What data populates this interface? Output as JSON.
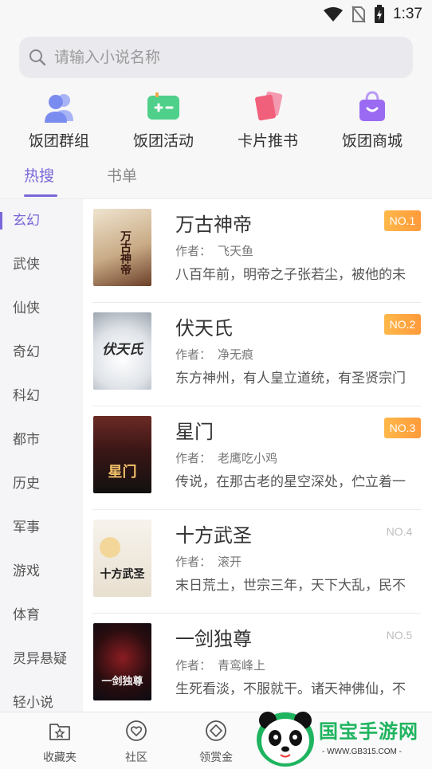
{
  "status_bar": {
    "time": "1:37",
    "icons": [
      "wifi-icon",
      "no-sim-icon",
      "battery-charging-icon"
    ]
  },
  "search": {
    "placeholder": "请输入小说名称",
    "icon": "search-icon"
  },
  "quick_actions": [
    {
      "label": "饭团群组",
      "icon": "group-icon",
      "color": "#7b8cf0"
    },
    {
      "label": "饭团活动",
      "icon": "gamepad-icon",
      "color": "#4fd08a"
    },
    {
      "label": "卡片推书",
      "icon": "cards-icon",
      "color": "#f0607a"
    },
    {
      "label": "饭团商城",
      "icon": "shopping-bag-icon",
      "color": "#9b6af2"
    }
  ],
  "tabs": [
    {
      "label": "热搜",
      "active": true
    },
    {
      "label": "书单",
      "active": false
    }
  ],
  "categories": [
    {
      "label": "玄幻",
      "active": true
    },
    {
      "label": "武侠"
    },
    {
      "label": "仙侠"
    },
    {
      "label": "奇幻"
    },
    {
      "label": "科幻"
    },
    {
      "label": "都市"
    },
    {
      "label": "历史"
    },
    {
      "label": "军事"
    },
    {
      "label": "游戏"
    },
    {
      "label": "体育"
    },
    {
      "label": "灵异悬疑"
    },
    {
      "label": "轻小说"
    }
  ],
  "books": [
    {
      "title": "万古神帝",
      "author_label": "作者：",
      "author": "飞天鱼",
      "description": "八百年前，明帝之子张若尘，被他的未",
      "rank": "NO.1",
      "highlight": true,
      "cover_text": "万古神帝",
      "cover_colors": [
        "#e9dcc3",
        "#8a5a3a"
      ]
    },
    {
      "title": "伏天氏",
      "author_label": "作者：",
      "author": "净无痕",
      "description": "东方神州，有人皇立道统，有圣贤宗门",
      "rank": "NO.2",
      "highlight": true,
      "cover_text": "伏天氏",
      "cover_colors": [
        "#e8eaee",
        "#b9c0c8"
      ]
    },
    {
      "title": "星门",
      "author_label": "作者：",
      "author": "老鹰吃小鸡",
      "description": "传说，在那古老的星空深处，伫立着一",
      "rank": "NO.3",
      "highlight": true,
      "cover_text": "星门",
      "cover_colors": [
        "#5a2320",
        "#1a1414"
      ]
    },
    {
      "title": "十方武圣",
      "author_label": "作者：",
      "author": "滚开",
      "description": "末日荒土，世宗三年，天下大乱，民不",
      "rank": "NO.4",
      "highlight": false,
      "cover_text": "十方武圣",
      "cover_colors": [
        "#f4efe6",
        "#d9cdb8"
      ]
    },
    {
      "title": "一剑独尊",
      "author_label": "作者：",
      "author": "青鸾峰上",
      "description": "生死看淡，不服就干。诸天神佛仙，不",
      "rank": "NO.5",
      "highlight": false,
      "cover_text": "一剑独尊",
      "cover_colors": [
        "#2a0d0f",
        "#0b0b12"
      ]
    }
  ],
  "bottom_nav": [
    {
      "label": "收藏夹",
      "icon": "favorites-icon"
    },
    {
      "label": "社区",
      "icon": "community-icon"
    },
    {
      "label": "领赏金",
      "icon": "reward-icon"
    }
  ],
  "watermark": {
    "title": "国宝手游网",
    "url": "- WWW.GB315.COM -"
  },
  "accent_color": "#7a66d8"
}
